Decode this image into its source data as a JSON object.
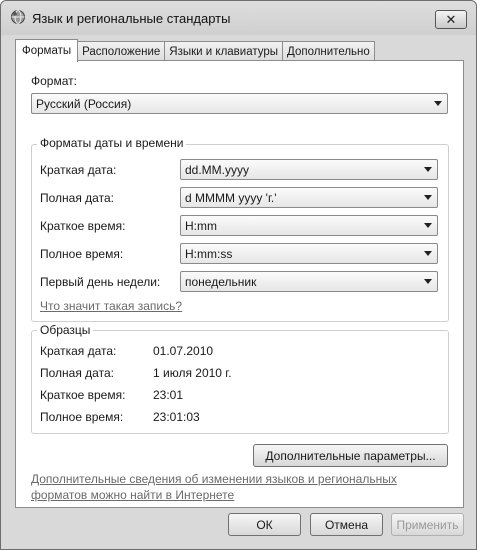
{
  "window": {
    "title": "Язык и региональные стандарты",
    "close_label": "✕"
  },
  "tabs": [
    {
      "label": "Форматы"
    },
    {
      "label": "Расположение"
    },
    {
      "label": "Языки и клавиатуры"
    },
    {
      "label": "Дополнительно"
    }
  ],
  "format": {
    "label": "Формат:",
    "value": "Русский (Россия)"
  },
  "datetime_group": {
    "title": "Форматы даты и времени",
    "rows": [
      {
        "label": "Краткая дата:",
        "value": "dd.MM.yyyy"
      },
      {
        "label": "Полная дата:",
        "value": "d MMMM yyyy 'г.'"
      },
      {
        "label": "Краткое время:",
        "value": "H:mm"
      },
      {
        "label": "Полное время:",
        "value": "H:mm:ss"
      },
      {
        "label": "Первый день недели:",
        "value": "понедельник"
      }
    ],
    "help_link": "Что значит такая запись?"
  },
  "samples_group": {
    "title": "Образцы",
    "rows": [
      {
        "label": "Краткая дата:",
        "value": "01.07.2010"
      },
      {
        "label": "Полная дата:",
        "value": "1 июля 2010 г."
      },
      {
        "label": "Краткое время:",
        "value": "23:01"
      },
      {
        "label": "Полное время:",
        "value": "23:01:03"
      }
    ]
  },
  "additional_settings_button": "Дополнительные параметры...",
  "info_link": {
    "line1": "Дополнительные сведения об изменении языков и региональных",
    "line2": "форматов можно найти в Интернете"
  },
  "footer": {
    "ok": "ОК",
    "cancel": "Отмена",
    "apply": "Применить"
  }
}
